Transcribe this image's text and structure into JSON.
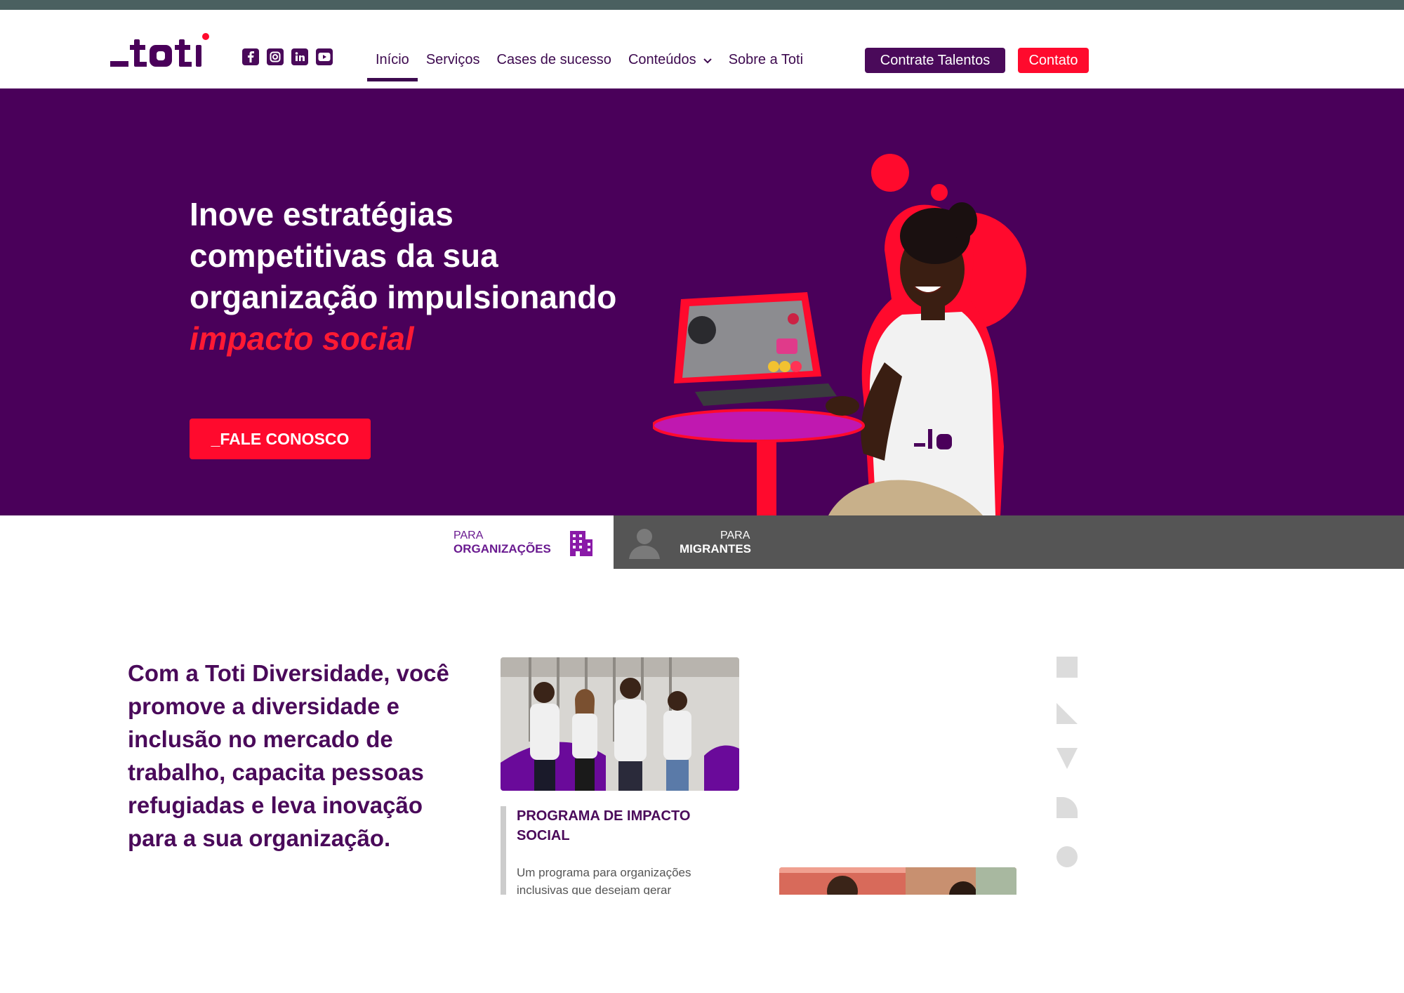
{
  "brand": {
    "logo_text": "_toti"
  },
  "socials": [
    {
      "icon": "facebook-icon"
    },
    {
      "icon": "instagram-icon"
    },
    {
      "icon": "linkedin-icon"
    },
    {
      "icon": "youtube-icon"
    }
  ],
  "nav": {
    "items": [
      {
        "label": "Início",
        "active": true
      },
      {
        "label": "Serviços"
      },
      {
        "label": "Cases de sucesso"
      },
      {
        "label": "Conteúdos",
        "has_dropdown": true
      },
      {
        "label": "Sobre a Toti"
      }
    ],
    "talentos_label": "Contrate Talentos",
    "contato_label": "Contato"
  },
  "hero": {
    "title_line1": "Inove estratégias",
    "title_line2": "competitivas da sua",
    "title_line3": "organização impulsionando",
    "title_accent": "impacto social",
    "cta_label": "_FALE CONOSCO"
  },
  "audience_tabs": {
    "org_small": "PARA",
    "org_big": "ORGANIZAÇÕES",
    "mig_small": "PARA",
    "mig_big": "MIGRANTES"
  },
  "content": {
    "intro": "Com a Toti Diversidade, você promove a diversidade e inclusão no mercado de trabalho, capacita pessoas refugiadas e leva inovação para a sua organização.",
    "card1": {
      "title": "PROGRAMA DE IMPACTO SOCIAL",
      "text": "Um programa para organizações inclusivas que desejam gerar"
    }
  },
  "colors": {
    "purple": "#4a005a",
    "red": "#ff0a2d",
    "gray_tab": "#555555",
    "top_strip": "#4a6060"
  }
}
